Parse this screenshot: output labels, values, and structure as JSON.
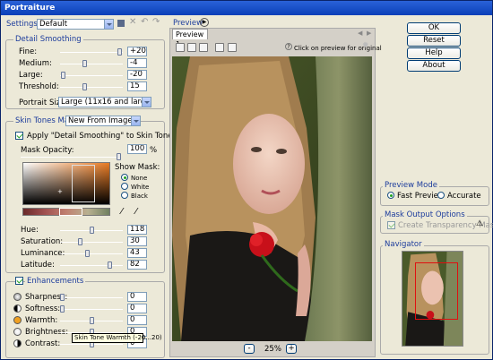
{
  "window": {
    "title": "Portraiture"
  },
  "settings": {
    "label": "Settings:",
    "value": "Default"
  },
  "detail_smoothing": {
    "title": "Detail Smoothing",
    "rows": [
      {
        "label": "Fine:",
        "value": "+20",
        "level": 0.98
      },
      {
        "label": "Medium:",
        "value": "-4",
        "level": 0.38
      },
      {
        "label": "Large:",
        "value": "-20",
        "level": 0.02
      },
      {
        "label": "Threshold:",
        "value": "15",
        "level": 0.38
      }
    ],
    "portrait_size_label": "Portrait Size:",
    "portrait_size_value": "Large (11x16 and larger)"
  },
  "skin_tones": {
    "title": "Skin Tones Mask:",
    "mask_value": "New From Image",
    "apply_label": "Apply \"Detail Smoothing\" to Skin Tones Only",
    "mask_opacity_label": "Mask Opacity:",
    "mask_opacity_value": "100",
    "percent": "%",
    "show_mask_label": "Show Mask:",
    "show_mask_options": [
      "None",
      "White",
      "Black"
    ],
    "rows": [
      {
        "label": "Hue:",
        "value": "118",
        "level": 0.5
      },
      {
        "label": "Saturation:",
        "value": "30",
        "level": 0.3
      },
      {
        "label": "Luminance:",
        "value": "43",
        "level": 0.43
      },
      {
        "label": "Latitude:",
        "value": "82",
        "level": 0.82
      }
    ]
  },
  "enhancements": {
    "title": "Enhancements",
    "rows": [
      {
        "label": "Sharpness:",
        "value": "0",
        "level": 0.0
      },
      {
        "label": "Softness:",
        "value": "0",
        "level": 0.0
      },
      {
        "label": "Warmth:",
        "value": "0",
        "level": 0.5
      },
      {
        "label": "Brightness:",
        "value": "0",
        "level": 0.5
      },
      {
        "label": "Contrast:",
        "value": "0",
        "level": 0.5
      }
    ],
    "tooltip": "Skin Tone Warmth (-20...20)"
  },
  "preview": {
    "label": "Preview",
    "tab": "Preview 1",
    "hint": "Click on preview for original",
    "zoom": "25%",
    "minus": "-",
    "plus": "+"
  },
  "buttons": {
    "ok": "OK",
    "reset": "Reset",
    "help": "Help",
    "about": "About"
  },
  "preview_mode": {
    "title": "Preview Mode",
    "options": [
      "Fast Preview",
      "Accurate"
    ]
  },
  "mask_output": {
    "title": "Mask Output Options",
    "create_label": "Create Transparency Mask"
  },
  "navigator": {
    "title": "Navigator"
  },
  "colors": {
    "accent": "#1c3c9c",
    "title_bar": "#0a3fb8",
    "warmth_dot": "#f0a020"
  }
}
